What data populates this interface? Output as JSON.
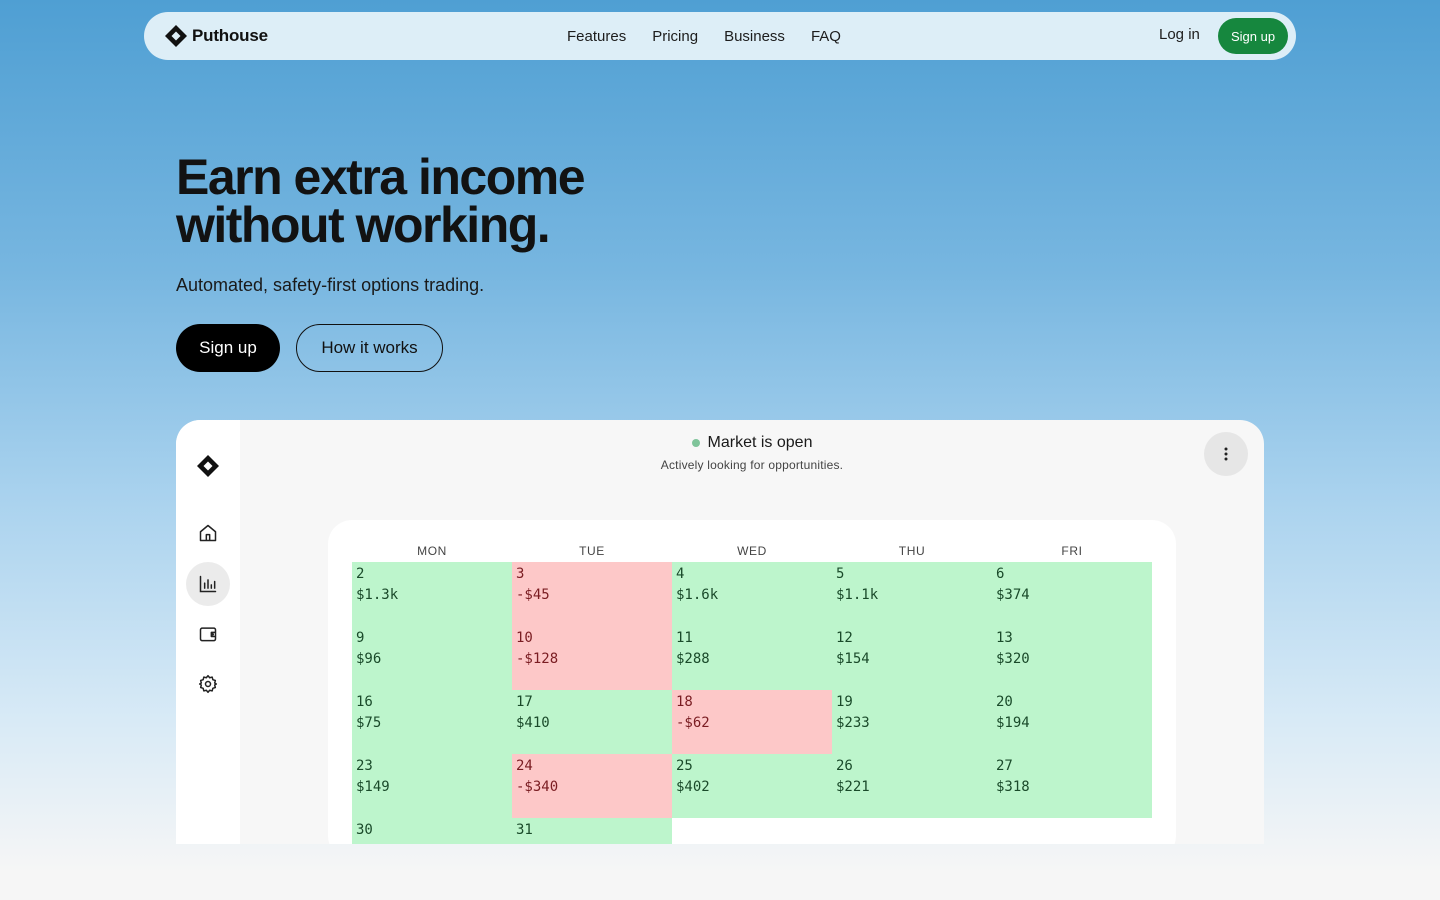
{
  "nav": {
    "brand": "Puthouse",
    "links": [
      "Features",
      "Pricing",
      "Business",
      "FAQ"
    ],
    "login": "Log in",
    "signup": "Sign up"
  },
  "hero": {
    "title_line1": "Earn extra income",
    "title_line2": "without working.",
    "subtitle": "Automated, safety-first options trading.",
    "primary_cta": "Sign up",
    "secondary_cta": "How it works"
  },
  "app": {
    "sidebar_icons": [
      "logo-icon",
      "home-icon",
      "chart-icon",
      "wallet-icon",
      "gear-icon"
    ],
    "active_item": "chart-icon",
    "status_title": "Market is open",
    "status_subtitle": "Actively looking for opportunities.",
    "status_color": "#7fc49a",
    "menu_icon": "more-vertical-icon",
    "calendar": {
      "weekdays": [
        "MON",
        "TUE",
        "WED",
        "THU",
        "FRI"
      ],
      "days": [
        {
          "day": "2",
          "value": "$1.3k",
          "type": "gain"
        },
        {
          "day": "3",
          "value": "-$45",
          "type": "loss"
        },
        {
          "day": "4",
          "value": "$1.6k",
          "type": "gain"
        },
        {
          "day": "5",
          "value": "$1.1k",
          "type": "gain"
        },
        {
          "day": "6",
          "value": "$374",
          "type": "gain"
        },
        {
          "day": "9",
          "value": "$96",
          "type": "gain"
        },
        {
          "day": "10",
          "value": "-$128",
          "type": "loss"
        },
        {
          "day": "11",
          "value": "$288",
          "type": "gain"
        },
        {
          "day": "12",
          "value": "$154",
          "type": "gain"
        },
        {
          "day": "13",
          "value": "$320",
          "type": "gain"
        },
        {
          "day": "16",
          "value": "$75",
          "type": "gain"
        },
        {
          "day": "17",
          "value": "$410",
          "type": "gain"
        },
        {
          "day": "18",
          "value": "-$62",
          "type": "loss"
        },
        {
          "day": "19",
          "value": "$233",
          "type": "gain"
        },
        {
          "day": "20",
          "value": "$194",
          "type": "gain"
        },
        {
          "day": "23",
          "value": "$149",
          "type": "gain"
        },
        {
          "day": "24",
          "value": "-$340",
          "type": "loss"
        },
        {
          "day": "25",
          "value": "$402",
          "type": "gain"
        },
        {
          "day": "26",
          "value": "$221",
          "type": "gain"
        },
        {
          "day": "27",
          "value": "$318",
          "type": "gain"
        },
        {
          "day": "30",
          "value": "",
          "type": "gain"
        },
        {
          "day": "31",
          "value": "",
          "type": "gain"
        }
      ],
      "gain_color": "#bdf5cc",
      "loss_color": "#fdc8c8"
    }
  },
  "colors": {
    "accent_green": "#16873e",
    "primary_button": "#000000"
  }
}
